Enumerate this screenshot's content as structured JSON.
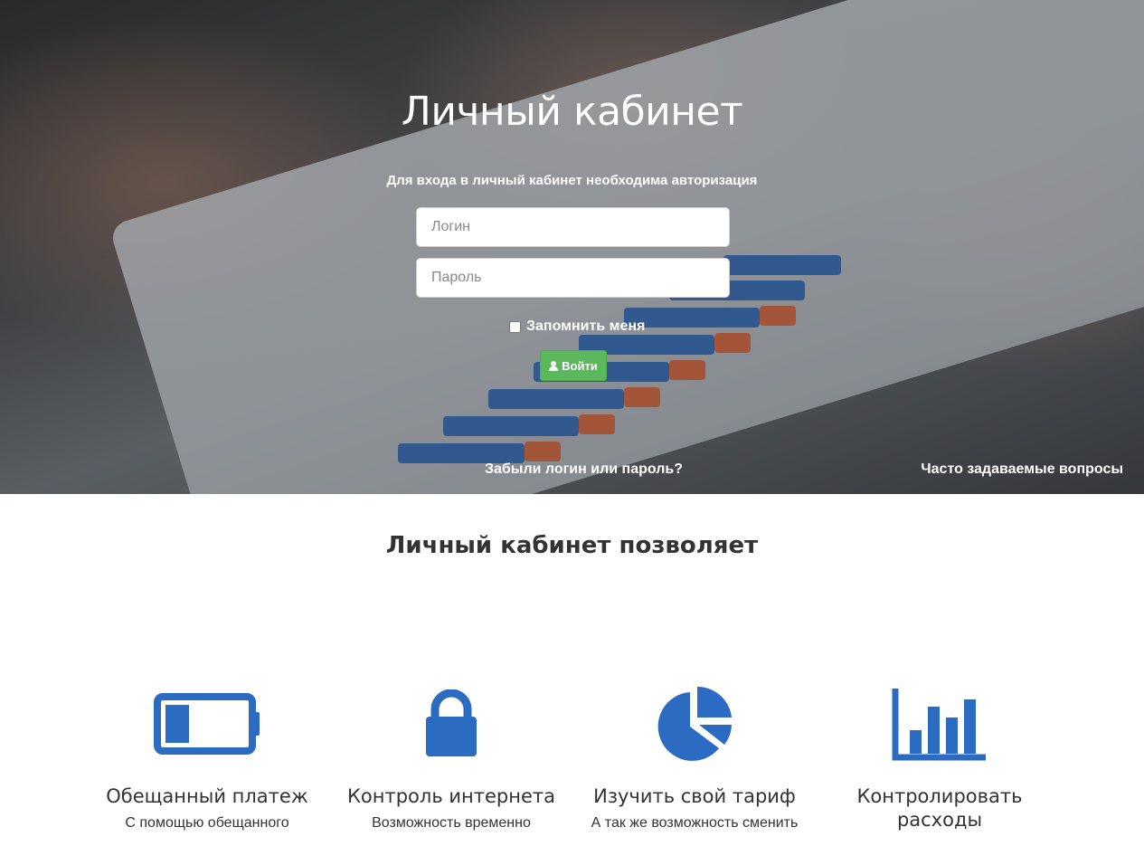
{
  "hero": {
    "title": "Личный кабинет",
    "subtitle": "Для входа в личный кабинет необходима авторизация",
    "login_placeholder": "Логин",
    "password_placeholder": "Пароль",
    "remember_label": "Запомнить меня",
    "login_button_label": "Войти",
    "forgot_link": "Забыли логин или пароль?",
    "faq_link": "Часто задаваемые вопросы"
  },
  "features_section": {
    "title": "Личный кабинет позволяет",
    "items": [
      {
        "icon": "battery-icon",
        "title": "Обещанный платеж",
        "text": "С помощью обещанного"
      },
      {
        "icon": "lock-icon",
        "title": "Контроль интернета",
        "text": "Возможность временно"
      },
      {
        "icon": "pie-chart-icon",
        "title": "Изучить свой тариф",
        "text": "А так же возможность сменить"
      },
      {
        "icon": "bar-chart-icon",
        "title": "Контролировать расходы",
        "text": ""
      }
    ]
  },
  "colors": {
    "accent_blue": "#2c6bc2",
    "button_green": "#5cb85c",
    "text_dark": "#333333"
  }
}
